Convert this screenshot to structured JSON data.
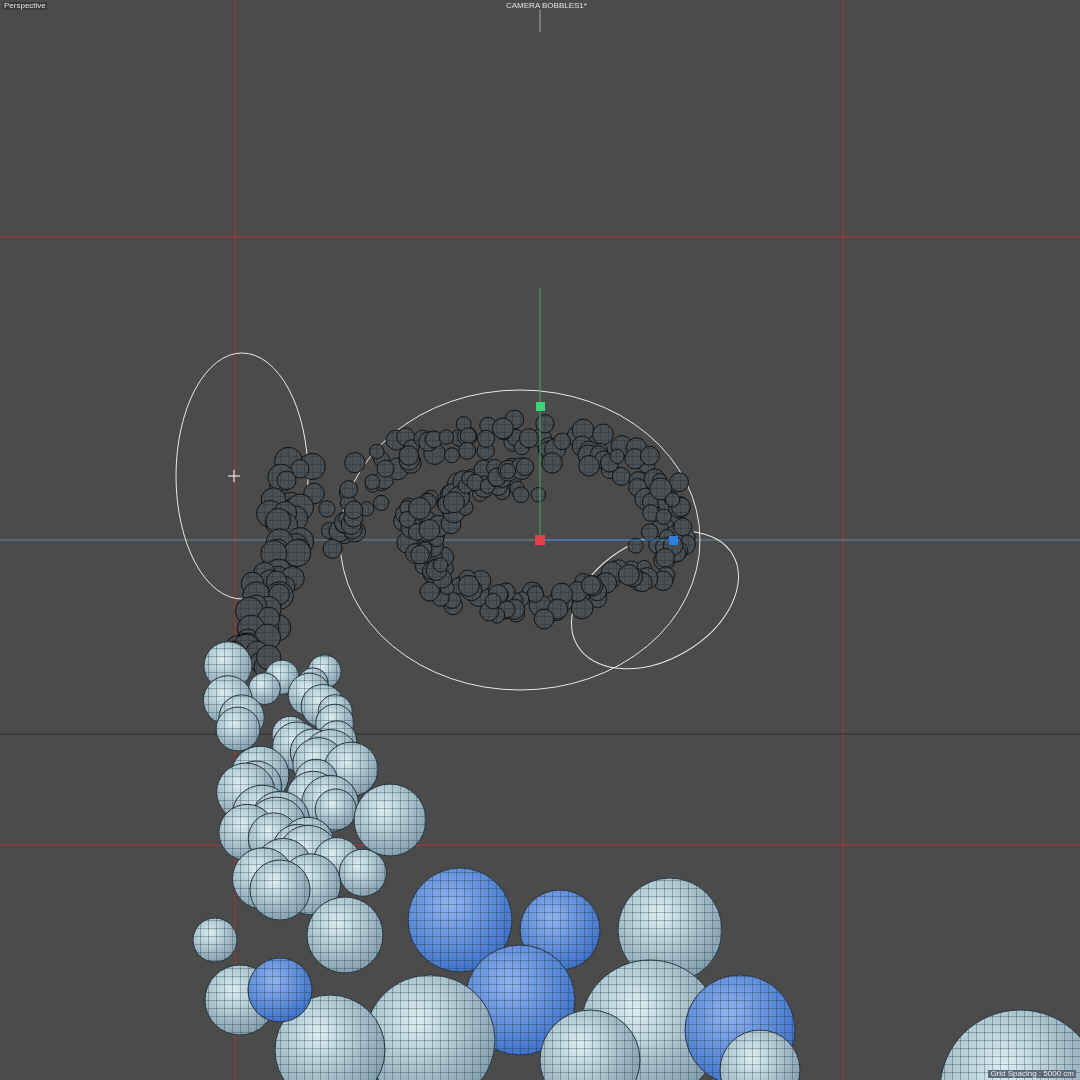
{
  "viewport": {
    "view_name": "Perspective",
    "camera_name": "CAMERA BOBBLES1*",
    "grid_spacing": "Grid Spacing : 5000 cm"
  }
}
